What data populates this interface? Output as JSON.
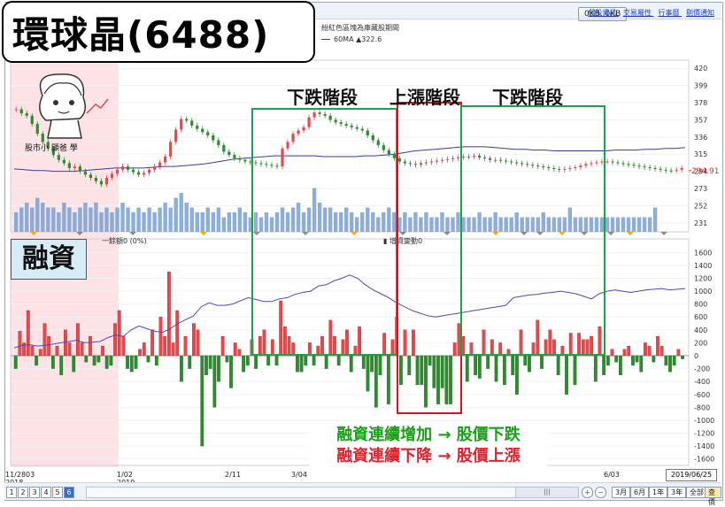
{
  "title": "環球晶(6488)",
  "topbar": {
    "button": "0KB, 0KB",
    "links": [
      "個股資訊",
      "交易屬性",
      "行事曆",
      "剔價通知"
    ]
  },
  "legend": {
    "line1": "紛紅色區塊為庫藏股期間",
    "line2": "60MA ▲322.6"
  },
  "phases": [
    "下跌階段",
    "上漲階段",
    "下跌階段"
  ],
  "margin_label": "融資",
  "subchart_legend": {
    "left": "一餘額0 (0%)",
    "right": "▮ 增資變動0"
  },
  "avatar_text": "股市小 顯爸 學",
  "notes": {
    "line1": "融資連續增加 → 股價下跌",
    "line2": "融資連續下降 → 股價上漲"
  },
  "current_price": "294.91",
  "date_box": "2019/06/25",
  "x_labels": [
    {
      "text": "11/2803",
      "sub": "2018"
    },
    {
      "text": "1/02",
      "sub": "2019"
    },
    {
      "text": "2/11",
      "sub": ""
    },
    {
      "text": "3/04",
      "sub": ""
    },
    {
      "text": "6/03",
      "sub": ""
    }
  ],
  "pages": [
    "1",
    "2",
    "3",
    "4",
    "5",
    "6"
  ],
  "page_active": "6",
  "scroll_label": "|||",
  "range_buttons": [
    "3月",
    "6月",
    "1年",
    "3年",
    "全部",
    "查價"
  ],
  "colors": {
    "up": "#e5484d",
    "down": "#2e8b2e",
    "volume": "#7aa0d0",
    "ma": "#3a3aa8",
    "margin_line": "#4a4ab8",
    "treasury_zone": "#fde3e6",
    "phase_down": "#1aa34a",
    "phase_up": "#e0101a"
  },
  "chart_data": [
    {
      "type": "candlestick",
      "title": "",
      "y_ticks": [
        420,
        399,
        378,
        357,
        336,
        315,
        294,
        273,
        252,
        231
      ],
      "ylim": [
        220,
        430
      ],
      "current_price": 294.91,
      "ma60_value": 322.6,
      "ma60": [
        297,
        296,
        295,
        295,
        294,
        294,
        294,
        295,
        296,
        297,
        298,
        298,
        298,
        298,
        299,
        300,
        300,
        301,
        302,
        303,
        305,
        307,
        309,
        310,
        311,
        312,
        313,
        313,
        313,
        313,
        313,
        312,
        312,
        312,
        312,
        313,
        313,
        314,
        315,
        317,
        319,
        320,
        321,
        322,
        323,
        324,
        324,
        324,
        323,
        322,
        321,
        321,
        320,
        320,
        319,
        319,
        319,
        319,
        319,
        319,
        320,
        320,
        320,
        321,
        321,
        322,
        322,
        323
      ],
      "closes": [
        370,
        365,
        362,
        352,
        340,
        330,
        322,
        314,
        308,
        304,
        298,
        300,
        294,
        290,
        286,
        282,
        278,
        286,
        291,
        296,
        300,
        296,
        293,
        290,
        292,
        296,
        300,
        305,
        312,
        330,
        345,
        358,
        356,
        350,
        346,
        342,
        338,
        332,
        326,
        318,
        314,
        310,
        308,
        306,
        305,
        304,
        303,
        302,
        301,
        300,
        322,
        330,
        340,
        344,
        348,
        360,
        366,
        364,
        362,
        357,
        354,
        352,
        350,
        348,
        346,
        344,
        338,
        332,
        326,
        320,
        315,
        310,
        306,
        304,
        303,
        302,
        304,
        305,
        306,
        307,
        308,
        309,
        310,
        311,
        312,
        312,
        313,
        311,
        310,
        308,
        308,
        307,
        306,
        305,
        304,
        303,
        302,
        301,
        300,
        299,
        298,
        297,
        296,
        297,
        298,
        299,
        301,
        303,
        304,
        305,
        306,
        306,
        305,
        304,
        303,
        302,
        301,
        300,
        299,
        298,
        297,
        296,
        295,
        294.91,
        296,
        298
      ],
      "volume": [
        0.4,
        0.5,
        0.6,
        0.5,
        0.7,
        0.6,
        0.5,
        0.5,
        0.4,
        0.6,
        0.5,
        0.4,
        0.5,
        0.6,
        0.5,
        0.6,
        0.4,
        0.5,
        0.4,
        0.5,
        0.6,
        0.5,
        0.4,
        0.5,
        0.4,
        0.5,
        0.4,
        0.5,
        0.6,
        0.5,
        0.7,
        0.8,
        0.6,
        0.5,
        0.4,
        0.4,
        0.5,
        0.4,
        0.5,
        0.3,
        0.4,
        0.4,
        0.5,
        0.4,
        0.3,
        0.4,
        0.3,
        0.4,
        0.3,
        0.4,
        0.5,
        0.4,
        0.5,
        0.6,
        0.4,
        0.5,
        0.9,
        0.6,
        0.5,
        0.5,
        0.4,
        0.4,
        0.5,
        0.4,
        0.3,
        0.4,
        0.5,
        0.4,
        0.3,
        0.4,
        0.5,
        0.4,
        0.3,
        0.4,
        0.3,
        0.4,
        0.3,
        0.4,
        0.3,
        0.3,
        0.4,
        0.3,
        0.3,
        0.4,
        0.3,
        0.3,
        0.3,
        0.4,
        0.3,
        0.3,
        0.4,
        0.3,
        0.3,
        0.3,
        0.4,
        0.3,
        0.3,
        0.3,
        0.3,
        0.4,
        0.3,
        0.3,
        0.3,
        0.3,
        0.5,
        0.3,
        0.3,
        0.3,
        0.3,
        0.3,
        0.3,
        0.3,
        0.3,
        0.3,
        0.3,
        0.3,
        0.3,
        0.3,
        0.3,
        0.3,
        0.5
      ]
    },
    {
      "type": "bar",
      "title": "融資",
      "y_ticks": [
        1600,
        1400,
        1200,
        1000,
        800,
        600,
        400,
        200,
        0,
        -200,
        -400,
        -600,
        -800,
        -1000,
        -1200,
        -1400,
        -1600
      ],
      "ylim": [
        -1700,
        1700
      ],
      "values": [
        -200,
        380,
        200,
        700,
        150,
        -150,
        100,
        500,
        300,
        -200,
        150,
        -300,
        400,
        200,
        -250,
        500,
        200,
        -100,
        300,
        -150,
        -100,
        150,
        -200,
        -150,
        500,
        700,
        300,
        -200,
        -250,
        -200,
        100,
        200,
        -100,
        400,
        -150,
        600,
        300,
        1300,
        200,
        700,
        -400,
        300,
        -200,
        500,
        400,
        -1400,
        -300,
        -200,
        -800,
        -400,
        300,
        -100,
        -500,
        200,
        100,
        -250,
        -150,
        250,
        -200,
        300,
        400,
        -150,
        250,
        -150,
        850,
        450,
        300,
        200,
        -250,
        -250,
        -150,
        200,
        -150,
        150,
        300,
        -200,
        550,
        300,
        -150,
        250,
        400,
        -250,
        150,
        450,
        -200,
        -550,
        -250,
        -800,
        -300,
        350,
        -750,
        250,
        600,
        -450,
        400,
        -300,
        400,
        -450,
        -450,
        -800,
        -150,
        -500,
        -750,
        -500,
        -750,
        -750,
        200,
        500,
        300,
        -400,
        200,
        -300,
        -350,
        400,
        -200,
        250,
        -400,
        200,
        -450,
        100,
        -300,
        -600,
        400,
        -150,
        -250,
        200,
        550,
        -200,
        250,
        400,
        250,
        -300,
        150,
        -600,
        350,
        -450,
        350,
        250,
        250,
        300,
        -400,
        450,
        -300,
        -150,
        100,
        -100,
        -300,
        100,
        150,
        -150,
        -100,
        -250,
        200,
        150,
        -100,
        300,
        150,
        -150,
        -250,
        -150,
        100,
        -50
      ],
      "balance_line": [
        120,
        160,
        170,
        150,
        160,
        180,
        200,
        220,
        240,
        200,
        210,
        220,
        280,
        320,
        300,
        400,
        460,
        420,
        380,
        360,
        420,
        500,
        560,
        620,
        760,
        820,
        780,
        780,
        800,
        850,
        900,
        870,
        840,
        840,
        880,
        900,
        950,
        980,
        1000,
        1080,
        1100,
        1160,
        1200,
        1250,
        1200,
        1100,
        1020,
        960,
        900,
        820,
        760,
        700,
        660,
        620,
        600,
        620,
        640,
        660,
        680,
        700,
        720,
        740,
        760,
        780,
        900,
        920,
        940,
        950,
        970,
        980,
        1000,
        980,
        960,
        920,
        880,
        960,
        1000,
        1020,
        1000,
        980,
        1000,
        1020,
        1030,
        1040,
        1020,
        1030,
        1040
      ]
    }
  ]
}
